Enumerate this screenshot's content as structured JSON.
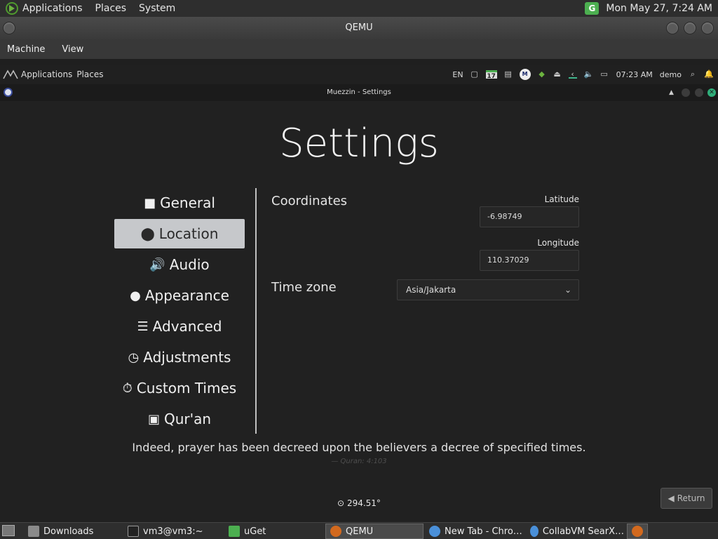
{
  "host_top": {
    "menus": [
      "Applications",
      "Places",
      "System"
    ],
    "datetime": "Mon May 27,  7:24 AM"
  },
  "qemu": {
    "title": "QEMU",
    "menus": [
      "Machine",
      "View"
    ]
  },
  "guest_panel": {
    "menus": [
      "Applications",
      "Places"
    ],
    "lang": "EN",
    "calendar_day": "17",
    "time": "07:23 AM",
    "user": "demo"
  },
  "app": {
    "window_title": "Muezzin - Settings",
    "page_title": "Settings",
    "nav": [
      {
        "label": "General",
        "icon": "kaaba-icon",
        "glyph": "🕋"
      },
      {
        "label": "Location",
        "icon": "map-pin-icon",
        "glyph": "📍"
      },
      {
        "label": "Audio",
        "icon": "speaker-icon",
        "glyph": "🔊"
      },
      {
        "label": "Appearance",
        "icon": "palette-icon",
        "glyph": "🎨"
      },
      {
        "label": "Advanced",
        "icon": "sliders-icon",
        "glyph": "☰"
      },
      {
        "label": "Adjustments",
        "icon": "clock-icon",
        "glyph": "🕓"
      },
      {
        "label": "Custom Times",
        "icon": "stopwatch-icon",
        "glyph": "⏱"
      },
      {
        "label": "Qur'an",
        "icon": "quran-icon",
        "glyph": "📖"
      }
    ],
    "active_nav": "Location",
    "location": {
      "coordinates_label": "Coordinates",
      "latitude_label": "Latitude",
      "latitude_value": "-6.98749",
      "longitude_label": "Longitude",
      "longitude_value": "110.37029",
      "timezone_label": "Time zone",
      "timezone_value": "Asia/Jakarta"
    },
    "quote": "Indeed, prayer has been decreed upon the believers a decree of specified times.",
    "quote_ref": "— Quran: 4:103",
    "qibla": "294.51°",
    "return_label": "Return"
  },
  "taskbar": {
    "items": [
      {
        "label": "Downloads"
      },
      {
        "label": "vm3@vm3:~"
      },
      {
        "label": "uGet"
      },
      {
        "label": "QEMU"
      },
      {
        "label": "New Tab - Chro…"
      },
      {
        "label": "CollabVM SearX…"
      }
    ]
  }
}
